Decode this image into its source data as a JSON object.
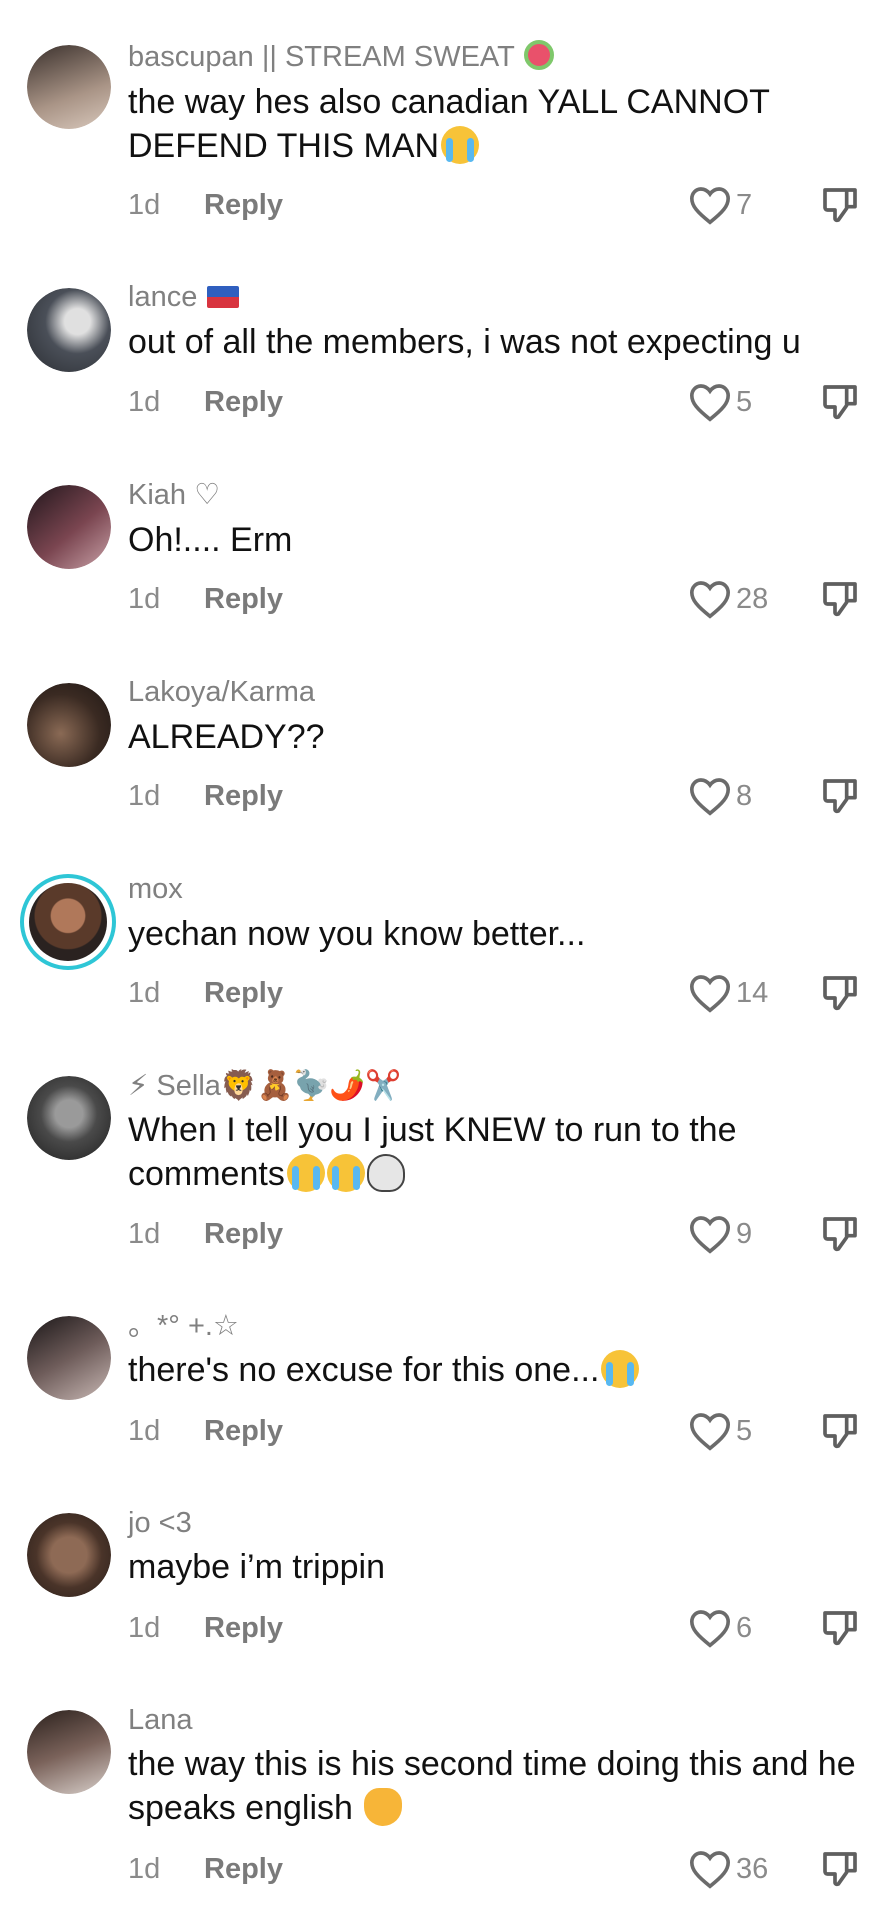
{
  "reply_label": "Reply",
  "comments": [
    {
      "username": "bascupan || STREAM SWEAT",
      "text": "the way hes also canadian YALL CANNOT DEFEND THIS MAN",
      "time": "1d",
      "likes": "7",
      "avatar_color": "#7a6a60"
    },
    {
      "username": "lance",
      "text": "out of all the members, i was not expecting u",
      "time": "1d",
      "likes": "5",
      "avatar_color": "#5a5e66"
    },
    {
      "username": "Kiah ♡",
      "text": "Oh!.... Erm",
      "time": "1d",
      "likes": "28",
      "avatar_color": "#5b3a46"
    },
    {
      "username": "Lakoya/Karma",
      "text": "ALREADY??",
      "time": "1d",
      "likes": "8",
      "avatar_color": "#3f2e24"
    },
    {
      "username": "mox",
      "text": "yechan now you know better...",
      "time": "1d",
      "likes": "14",
      "avatar_color": "#7b4f36"
    },
    {
      "username": "⚡ Sella🦁🧸🦤🌶️✂️",
      "text": "When I tell you I just KNEW to run to the comments",
      "time": "1d",
      "likes": "9",
      "avatar_color": "#3a3a3a"
    },
    {
      "username": "。*° +.☆",
      "text": "there's no excuse for this one...",
      "time": "1d",
      "likes": "5",
      "avatar_color": "#2f2a2b"
    },
    {
      "username": "jo <3",
      "text": "maybe i’m trippin",
      "time": "1d",
      "likes": "6",
      "avatar_color": "#6a4a3a"
    },
    {
      "username": "Lana",
      "text": "the way this is his second time doing this and he speaks english",
      "time": "1d",
      "likes": "36",
      "avatar_color": "#4a3a33"
    }
  ]
}
